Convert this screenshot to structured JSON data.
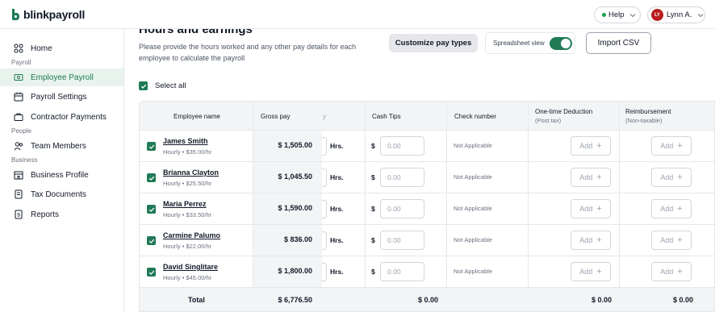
{
  "app": {
    "brand": "blinkpayroll",
    "brand_color": "#1f7a55"
  },
  "header": {
    "help_label": "Help",
    "user_initials": "LY",
    "user_name": "Lynn A."
  },
  "sidebar": {
    "home": "Home",
    "section_payroll": "Payroll",
    "employee_payroll": "Employee Payroll",
    "payroll_settings": "Payroll Settings",
    "contractor_payments": "Contractor Payments",
    "section_people": "People",
    "team_members": "Team Members",
    "section_business": "Business",
    "business_profile": "Business Profile",
    "tax_documents": "Tax Documents",
    "reports": "Reports"
  },
  "main": {
    "title": "Hours and earnings",
    "description": "Please provide the hours worked and any other pay details for each employee to calculate the payroll",
    "customize_label": "Customize pay types",
    "spreadsheet_label": "Spreadsheet view",
    "spreadsheet_on": true,
    "import_label": "Import CSV",
    "select_all_label": "Select all"
  },
  "table": {
    "headers": {
      "employee": "Employee name",
      "gross": "Gross pay",
      "partial": "y",
      "tips": "Cash Tips",
      "check": "Check number",
      "deduction": "One-time Deduction",
      "deduction_sub": "(Post tax)",
      "reimbursement": "Reimbursement",
      "reimbursement_sub": "(Non-taxable)"
    },
    "rows": [
      {
        "name": "James Smith",
        "rate": "Hourly  •  $35.00/hr",
        "gross": "$ 1,505.00",
        "hrs": "Hrs.",
        "dollar": "$",
        "tip_placeholder": "0.00",
        "check": "Not Applicable",
        "add": "Add"
      },
      {
        "name": "Brianna Clayton",
        "rate": "Hourly  •  $25.50/hr",
        "gross": "$ 1,045.50",
        "hrs": "Hrs.",
        "dollar": "$",
        "tip_placeholder": "0.00",
        "check": "Not Applicable",
        "add": "Add"
      },
      {
        "name": "Maria Perrez",
        "rate": "Hourly  •  $33.50/hr",
        "gross": "$ 1,590.00",
        "hrs": "Hrs.",
        "dollar": "$",
        "tip_placeholder": "0.00",
        "check": "Not Applicable",
        "add": "Add"
      },
      {
        "name": "Carmine Palumo",
        "rate": "Hourly  •  $22.00/hr",
        "gross": "$ 836.00",
        "hrs": "Hrs.",
        "dollar": "$",
        "tip_placeholder": "0.00",
        "check": "Not Applicable",
        "add": "Add"
      },
      {
        "name": "David Singlitare",
        "rate": "Hourly  •  $45.00/hr",
        "gross": "$ 1,800.00",
        "hrs": "Hrs.",
        "dollar": "$",
        "tip_placeholder": "0.00",
        "check": "Not Applicable",
        "add": "Add"
      }
    ],
    "total": {
      "label": "Total",
      "gross": "$ 6,776.50",
      "tips": "$ 0.00",
      "deduction": "$ 0.00",
      "reimbursement": "$ 0.00"
    }
  }
}
